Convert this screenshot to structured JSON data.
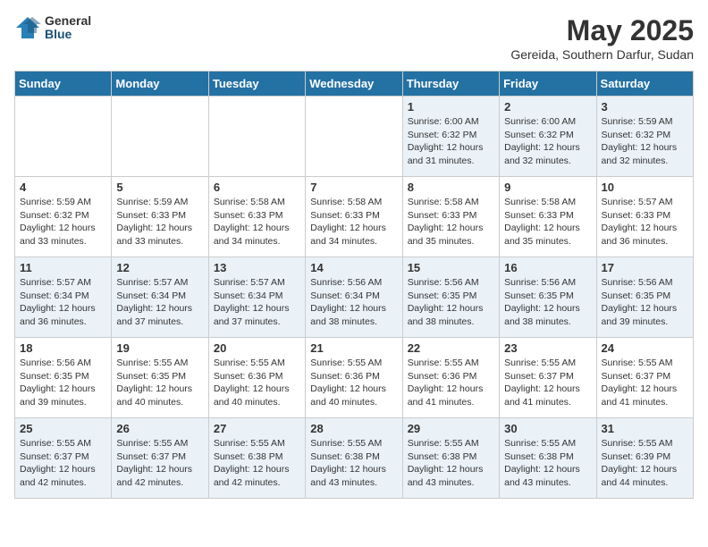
{
  "header": {
    "logo_general": "General",
    "logo_blue": "Blue",
    "month": "May 2025",
    "location": "Gereida, Southern Darfur, Sudan"
  },
  "weekdays": [
    "Sunday",
    "Monday",
    "Tuesday",
    "Wednesday",
    "Thursday",
    "Friday",
    "Saturday"
  ],
  "weeks": [
    [
      {
        "day": "",
        "info": ""
      },
      {
        "day": "",
        "info": ""
      },
      {
        "day": "",
        "info": ""
      },
      {
        "day": "",
        "info": ""
      },
      {
        "day": "1",
        "info": "Sunrise: 6:00 AM\nSunset: 6:32 PM\nDaylight: 12 hours\nand 31 minutes."
      },
      {
        "day": "2",
        "info": "Sunrise: 6:00 AM\nSunset: 6:32 PM\nDaylight: 12 hours\nand 32 minutes."
      },
      {
        "day": "3",
        "info": "Sunrise: 5:59 AM\nSunset: 6:32 PM\nDaylight: 12 hours\nand 32 minutes."
      }
    ],
    [
      {
        "day": "4",
        "info": "Sunrise: 5:59 AM\nSunset: 6:32 PM\nDaylight: 12 hours\nand 33 minutes."
      },
      {
        "day": "5",
        "info": "Sunrise: 5:59 AM\nSunset: 6:33 PM\nDaylight: 12 hours\nand 33 minutes."
      },
      {
        "day": "6",
        "info": "Sunrise: 5:58 AM\nSunset: 6:33 PM\nDaylight: 12 hours\nand 34 minutes."
      },
      {
        "day": "7",
        "info": "Sunrise: 5:58 AM\nSunset: 6:33 PM\nDaylight: 12 hours\nand 34 minutes."
      },
      {
        "day": "8",
        "info": "Sunrise: 5:58 AM\nSunset: 6:33 PM\nDaylight: 12 hours\nand 35 minutes."
      },
      {
        "day": "9",
        "info": "Sunrise: 5:58 AM\nSunset: 6:33 PM\nDaylight: 12 hours\nand 35 minutes."
      },
      {
        "day": "10",
        "info": "Sunrise: 5:57 AM\nSunset: 6:33 PM\nDaylight: 12 hours\nand 36 minutes."
      }
    ],
    [
      {
        "day": "11",
        "info": "Sunrise: 5:57 AM\nSunset: 6:34 PM\nDaylight: 12 hours\nand 36 minutes."
      },
      {
        "day": "12",
        "info": "Sunrise: 5:57 AM\nSunset: 6:34 PM\nDaylight: 12 hours\nand 37 minutes."
      },
      {
        "day": "13",
        "info": "Sunrise: 5:57 AM\nSunset: 6:34 PM\nDaylight: 12 hours\nand 37 minutes."
      },
      {
        "day": "14",
        "info": "Sunrise: 5:56 AM\nSunset: 6:34 PM\nDaylight: 12 hours\nand 38 minutes."
      },
      {
        "day": "15",
        "info": "Sunrise: 5:56 AM\nSunset: 6:35 PM\nDaylight: 12 hours\nand 38 minutes."
      },
      {
        "day": "16",
        "info": "Sunrise: 5:56 AM\nSunset: 6:35 PM\nDaylight: 12 hours\nand 38 minutes."
      },
      {
        "day": "17",
        "info": "Sunrise: 5:56 AM\nSunset: 6:35 PM\nDaylight: 12 hours\nand 39 minutes."
      }
    ],
    [
      {
        "day": "18",
        "info": "Sunrise: 5:56 AM\nSunset: 6:35 PM\nDaylight: 12 hours\nand 39 minutes."
      },
      {
        "day": "19",
        "info": "Sunrise: 5:55 AM\nSunset: 6:35 PM\nDaylight: 12 hours\nand 40 minutes."
      },
      {
        "day": "20",
        "info": "Sunrise: 5:55 AM\nSunset: 6:36 PM\nDaylight: 12 hours\nand 40 minutes."
      },
      {
        "day": "21",
        "info": "Sunrise: 5:55 AM\nSunset: 6:36 PM\nDaylight: 12 hours\nand 40 minutes."
      },
      {
        "day": "22",
        "info": "Sunrise: 5:55 AM\nSunset: 6:36 PM\nDaylight: 12 hours\nand 41 minutes."
      },
      {
        "day": "23",
        "info": "Sunrise: 5:55 AM\nSunset: 6:37 PM\nDaylight: 12 hours\nand 41 minutes."
      },
      {
        "day": "24",
        "info": "Sunrise: 5:55 AM\nSunset: 6:37 PM\nDaylight: 12 hours\nand 41 minutes."
      }
    ],
    [
      {
        "day": "25",
        "info": "Sunrise: 5:55 AM\nSunset: 6:37 PM\nDaylight: 12 hours\nand 42 minutes."
      },
      {
        "day": "26",
        "info": "Sunrise: 5:55 AM\nSunset: 6:37 PM\nDaylight: 12 hours\nand 42 minutes."
      },
      {
        "day": "27",
        "info": "Sunrise: 5:55 AM\nSunset: 6:38 PM\nDaylight: 12 hours\nand 42 minutes."
      },
      {
        "day": "28",
        "info": "Sunrise: 5:55 AM\nSunset: 6:38 PM\nDaylight: 12 hours\nand 43 minutes."
      },
      {
        "day": "29",
        "info": "Sunrise: 5:55 AM\nSunset: 6:38 PM\nDaylight: 12 hours\nand 43 minutes."
      },
      {
        "day": "30",
        "info": "Sunrise: 5:55 AM\nSunset: 6:38 PM\nDaylight: 12 hours\nand 43 minutes."
      },
      {
        "day": "31",
        "info": "Sunrise: 5:55 AM\nSunset: 6:39 PM\nDaylight: 12 hours\nand 44 minutes."
      }
    ]
  ]
}
